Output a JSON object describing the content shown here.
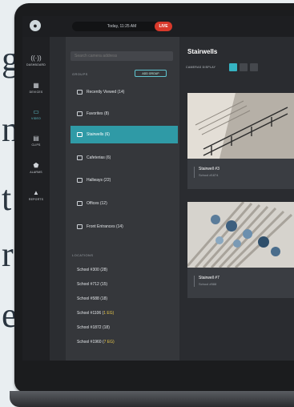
{
  "background_letters": [
    "g",
    "n",
    "t",
    "r",
    "e"
  ],
  "topbar": {
    "logo": "●",
    "date": "Today, 11:25 AM",
    "live": "LIVE"
  },
  "rail": [
    {
      "icon": "((·))",
      "label": "DASHBOARD"
    },
    {
      "icon": "▦",
      "label": "DEVICES"
    },
    {
      "icon": "▭",
      "label": "VIDEO"
    },
    {
      "icon": "▤",
      "label": "CLIPS"
    },
    {
      "icon": "⬟",
      "label": "ALARMS"
    },
    {
      "icon": "▲",
      "label": "REPORTS"
    }
  ],
  "panel": {
    "search_placeholder": "Search camera address",
    "groups_label": "GROUPS",
    "add_group": "ADD GROUP",
    "groups": [
      "Recently Viewed (14)",
      "Favorites (8)",
      "Stairwells (6)",
      "Cafeterias (6)",
      "Hallways (22)",
      "Offices (12)",
      "Front Entrances (14)"
    ],
    "locations_label": "LOCATIONS",
    "locations": [
      {
        "text": "School #300 (28)",
        "highlight": ""
      },
      {
        "text": "School #712 (15)",
        "highlight": ""
      },
      {
        "text": "School #588 (18)",
        "highlight": ""
      },
      {
        "text": "School #1106 (",
        "highlight": "1 EG"
      },
      {
        "text": "School #1872 (18)",
        "highlight": ""
      },
      {
        "text": "School #1960 (",
        "highlight": "7 EG"
      }
    ]
  },
  "main": {
    "title": "Stairwells",
    "filter_label": "CAMERAS DISPLAY",
    "layout_buttons": [
      "1",
      "2",
      "3"
    ],
    "cameras": [
      {
        "name": "Stairwell #3",
        "sub": "School #1874"
      },
      {
        "name": "Stairwell #7",
        "sub": "School #588"
      }
    ]
  },
  "colors": {
    "accent": "#2f9aa6",
    "live": "#d8392b",
    "highlight": "#e8c74a"
  }
}
